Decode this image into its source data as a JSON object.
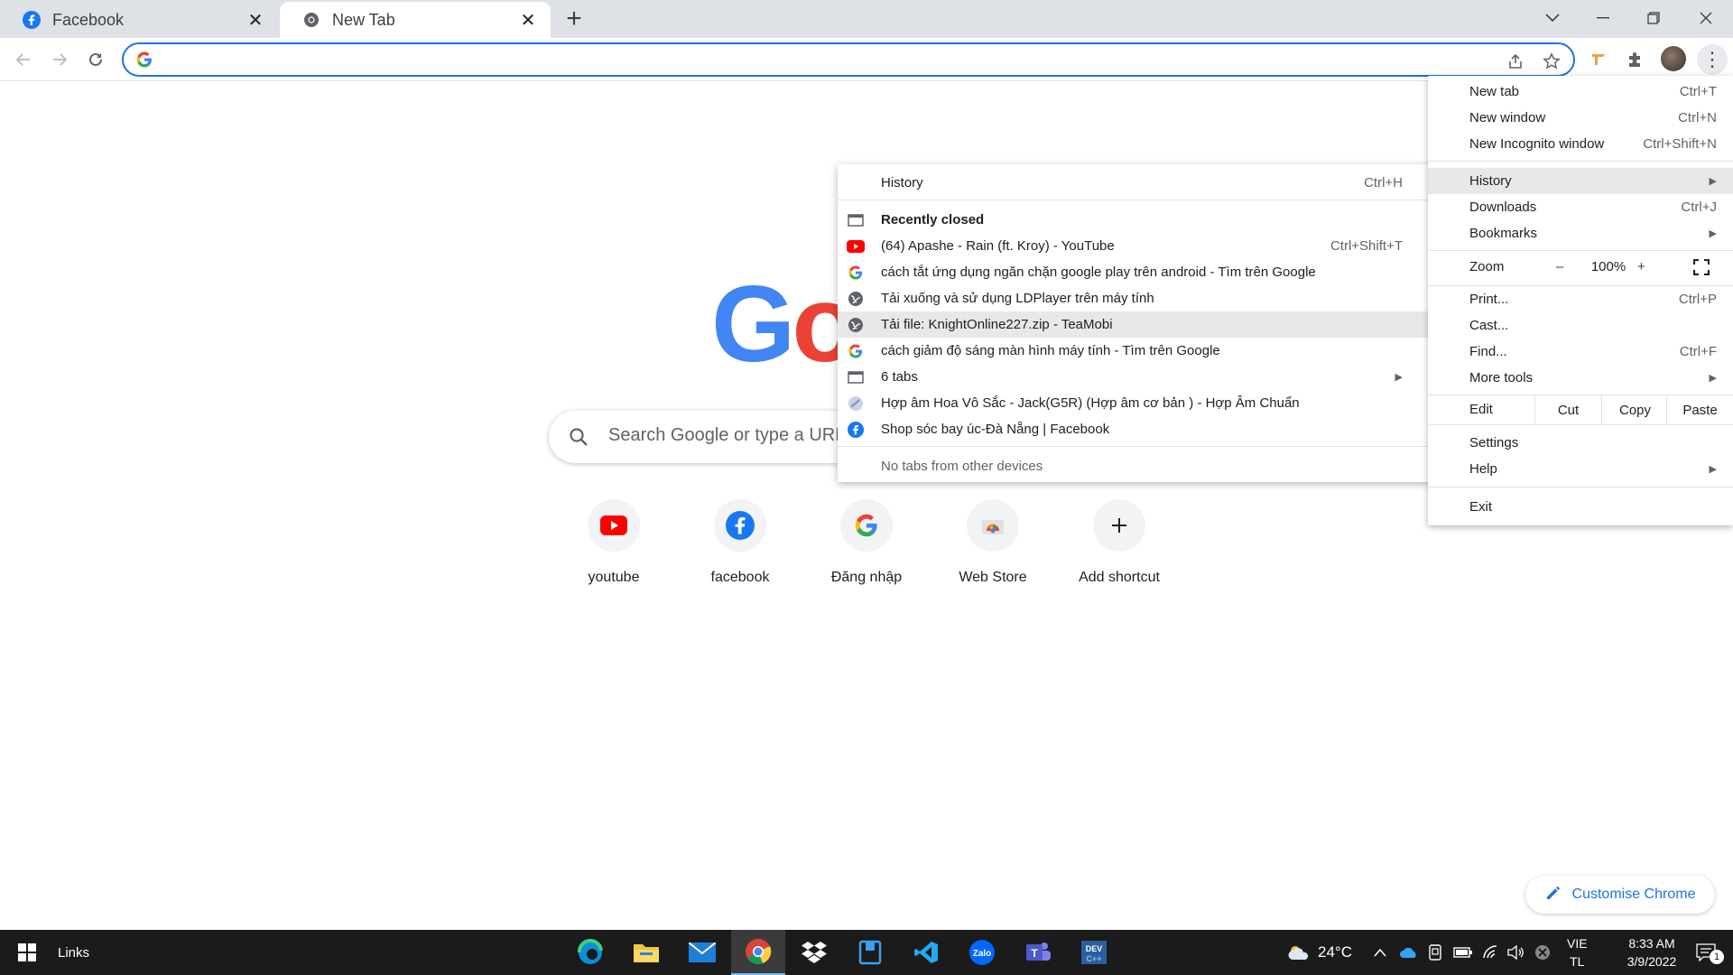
{
  "tabs": [
    {
      "title": "Facebook",
      "favicon": "facebook-icon",
      "active": false
    },
    {
      "title": "New Tab",
      "favicon": "chrome-icon",
      "active": true
    }
  ],
  "omnibox": {
    "value": "",
    "placeholder": ""
  },
  "ntp": {
    "search_placeholder": "Search Google or type a URL",
    "shortcuts": [
      {
        "label": "youtube",
        "icon": "youtube-icon"
      },
      {
        "label": "facebook",
        "icon": "facebook-icon"
      },
      {
        "label": "Đăng nhập",
        "icon": "google-icon"
      },
      {
        "label": "Web Store",
        "icon": "web-store-icon"
      },
      {
        "label": "Add shortcut",
        "icon": "plus-icon"
      }
    ],
    "customise_label": "Customise Chrome"
  },
  "menu": {
    "new_tab": {
      "label": "New tab",
      "shortcut": "Ctrl+T"
    },
    "new_window": {
      "label": "New window",
      "shortcut": "Ctrl+N"
    },
    "new_incognito": {
      "label": "New Incognito window",
      "shortcut": "Ctrl+Shift+N"
    },
    "history": {
      "label": "History"
    },
    "downloads": {
      "label": "Downloads",
      "shortcut": "Ctrl+J"
    },
    "bookmarks": {
      "label": "Bookmarks"
    },
    "zoom": {
      "label": "Zoom",
      "minus": "–",
      "value": "100%",
      "plus": "+"
    },
    "print": {
      "label": "Print...",
      "shortcut": "Ctrl+P"
    },
    "cast": {
      "label": "Cast..."
    },
    "find": {
      "label": "Find...",
      "shortcut": "Ctrl+F"
    },
    "more_tools": {
      "label": "More tools"
    },
    "edit": {
      "label": "Edit",
      "cut": "Cut",
      "copy": "Copy",
      "paste": "Paste"
    },
    "settings": {
      "label": "Settings"
    },
    "help": {
      "label": "Help"
    },
    "exit": {
      "label": "Exit"
    }
  },
  "history_menu": {
    "history": {
      "label": "History",
      "shortcut": "Ctrl+H"
    },
    "recently_closed": "Recently closed",
    "items": [
      {
        "label": "(64) Apashe - Rain (ft. Kroy) - YouTube",
        "shortcut": "Ctrl+Shift+T",
        "icon": "youtube-icon"
      },
      {
        "label": "cách tắt ứng dụng ngăn chặn google play trên android - Tìm trên Google",
        "shortcut": "",
        "icon": "google-icon"
      },
      {
        "label": "Tải xuống và sử dụng LDPlayer trên máy tính",
        "shortcut": "",
        "icon": "globe-icon"
      },
      {
        "label": "Tải file: KnightOnline227.zip - TeaMobi",
        "shortcut": "",
        "icon": "globe-icon"
      },
      {
        "label": "cách giảm độ sáng màn hình máy tính - Tìm trên Google",
        "shortcut": "",
        "icon": "google-icon"
      },
      {
        "label": "6 tabs",
        "shortcut": "",
        "icon": "window-icon"
      },
      {
        "label": "Hợp âm Hoa Vô Sắc - Jack(G5R) (Hợp âm cơ bản ) - Hợp Âm Chuẩn",
        "shortcut": "",
        "icon": "hopamchuan-icon"
      },
      {
        "label": "Shop sóc bay úc-Đà Nẵng | Facebook",
        "shortcut": "",
        "icon": "facebook-icon"
      }
    ],
    "no_tabs": "No tabs from other devices"
  },
  "taskbar": {
    "links_label": "Links",
    "weather": "24°C",
    "language": "VIE",
    "input_mode": "TL",
    "time": "8:33 AM",
    "date": "3/9/2022",
    "notification_count": "1"
  },
  "colors": {
    "accent": "#1a73e8",
    "tabstrip": "#dee1e6",
    "taskbar": "#1b1b1b"
  }
}
